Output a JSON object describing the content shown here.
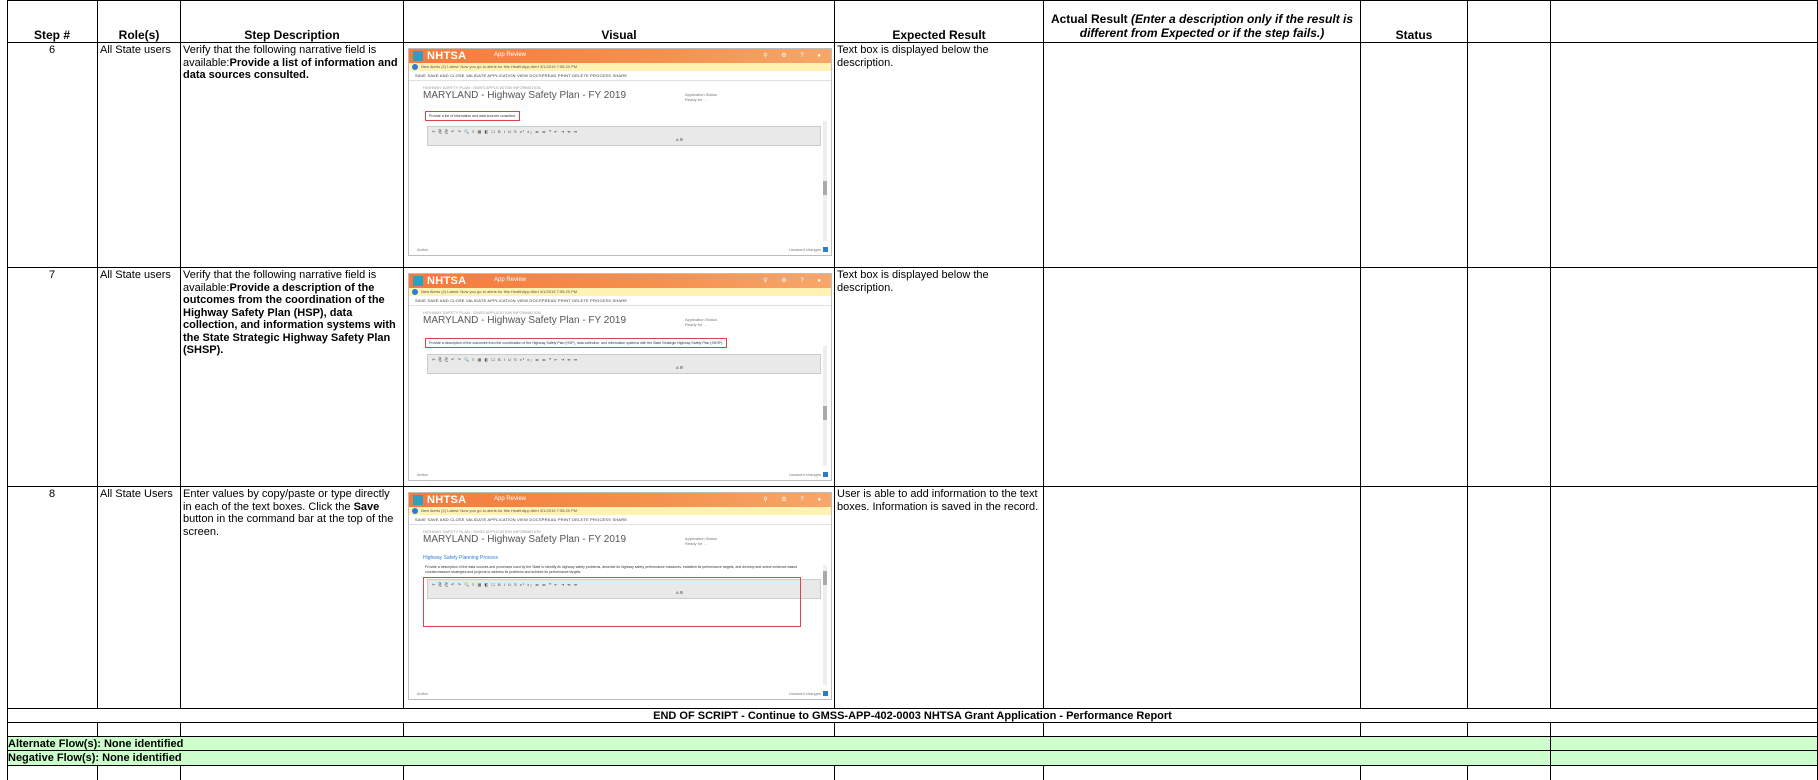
{
  "headers": {
    "step": "Step #",
    "role": "Role(s)",
    "description": "Step Description",
    "visual": "Visual",
    "expected": "Expected Result",
    "actual_prefix": "Actual Result ",
    "actual_italic": "(Enter a description only if the result is different from Expected or if the step fails.)",
    "status": "Status"
  },
  "rows": [
    {
      "step": "6",
      "role": "All State users",
      "desc_plain": "Verify that the following narrative field is available:",
      "desc_bold": "Provide a list of information and data sources consulted.",
      "expected": "Text box is displayed below the description.",
      "shot": {
        "brand": "NHTSA",
        "app_title": "App Review",
        "notice": "New Alerts (2)   Latest: Now you go to alerts for this HealthApp Alert   3/1/2019 7:55:20 PM",
        "commands": "SAVE   SAVE AND CLOSE   VALIDATE APPLICATION   VIEW   DOCSPREAD   PRINT   DELETE   PROCESS   SHARE",
        "crumb": "HIGHWAY SAFETY PLAN : GMSS APPLICATION INFORMATION",
        "title": "MARYLAND - Highway Safety Plan - FY 2019",
        "status_label": "Application Status",
        "status_value": "Ready for ...",
        "prompt": "Provide a list of information and data sources consulted.",
        "footer": "Active",
        "footer_right": "Unsaved changes"
      }
    },
    {
      "step": "7",
      "role": "All State users",
      "desc_plain": "Verify that the following narrative field is available:",
      "desc_bold": "Provide a description of the outcomes from the coordination of the Highway Safety Plan (HSP), data collection, and information systems with the State Strategic Highway Safety Plan (SHSP).",
      "expected": "Text box is displayed below the description.",
      "shot": {
        "brand": "NHTSA",
        "app_title": "App Review",
        "notice": "New Alerts (2)   Latest: Now you go to alerts for this HealthApp Alert   3/1/2019 7:55:20 PM",
        "commands": "SAVE   SAVE AND CLOSE   VALIDATE APPLICATION   VIEW   DOCSPREAD   PRINT   DELETE   PROCESS   SHARE",
        "crumb": "HIGHWAY SAFETY PLAN : GMSS APPLICATION INFORMATION",
        "title": "MARYLAND - Highway Safety Plan - FY 2019",
        "status_label": "Application Status",
        "status_value": "Ready for ...",
        "prompt": "Provide a description of the outcomes from the coordination of the Highway Safety Plan (HSP), data collection, and information systems with the State Strategic Highway Safety Plan (SHSP).",
        "footer": "Active",
        "footer_right": "Unsaved changes"
      }
    },
    {
      "step": "8",
      "role": "All State Users",
      "desc_a": "Enter values by copy/paste or type directly in each of the text boxes.  Click the ",
      "desc_bold": "Save",
      "desc_b": " button in the command bar at the top of the screen.",
      "expected": "User is able to add information to the text boxes.  Information is saved in the record.",
      "shot": {
        "brand": "NHTSA",
        "app_title": "App Review",
        "notice": "New Alerts (2)   Latest: Now you go to alerts for this HealthApp Alert   3/1/2019 7:55:20 PM",
        "commands": "SAVE   SAVE AND CLOSE   VALIDATE APPLICATION   VIEW   DOCSPREAD   PRINT   DELETE   PROCESS   SHARE",
        "crumb": "HIGHWAY SAFETY PLAN : GMSS APPLICATION INFORMATION",
        "title": "MARYLAND - Highway Safety Plan - FY 2019",
        "status_label": "Application Status",
        "status_value": "Ready for ...",
        "section": "Highway Safety Planning Process",
        "prompt": "Provide a description of the data sources and processes used by the State to identify its highway safety problems, describe its highway safety performance measures, establish its performance targets, and develop and select evidence-based countermeasure strategies and projects to address its problems and achieve its performance targets.",
        "footer": "Active",
        "footer_right": "Unsaved changes"
      }
    }
  ],
  "end_script": "END OF SCRIPT - Continue to GMSS-APP-402-0003 NHTSA Grant Application - Performance Report",
  "alternate_flows": "Alternate Flow(s): None identified",
  "negative_flows": "Negative Flow(s): None identified",
  "colors": {
    "green_band": "#ccffcc",
    "nhtsa_orange": "#f57a3d",
    "alert_red": "#dd4444"
  }
}
